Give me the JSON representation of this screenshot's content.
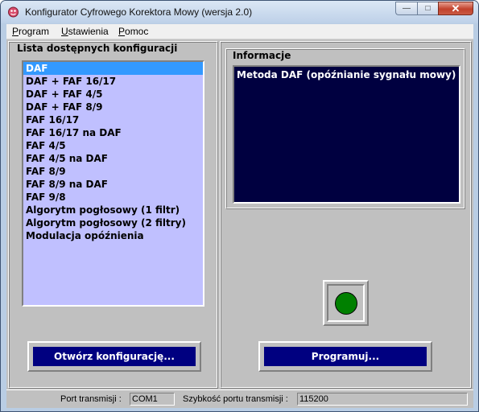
{
  "window": {
    "title": "Konfigurator Cyfrowego Korektora Mowy (wersja 2.0)"
  },
  "menu": [
    "Program",
    "Ustawienia",
    "Pomoc"
  ],
  "config_list": {
    "title": "Lista dostępnych konfiguracji",
    "selected": "DAF",
    "items": [
      "DAF",
      "DAF + FAF 16/17",
      "DAF + FAF 4/5",
      "DAF + FAF 8/9",
      "FAF 16/17",
      "FAF 16/17 na DAF",
      "FAF 4/5",
      "FAF 4/5 na DAF",
      "FAF 8/9",
      "FAF 8/9 na DAF",
      "FAF 9/8",
      "Algorytm pogłosowy (1 filtr)",
      "Algorytm pogłosowy (2 filtry)",
      "Modulacja opóźnienia"
    ]
  },
  "info": {
    "title": "Informacje",
    "text": "Metoda DAF (opóźnianie sygnału mowy)"
  },
  "status_led": {
    "state": "on",
    "color": "#008000"
  },
  "buttons": {
    "open": "Otwórz konfigurację...",
    "program": "Programuj..."
  },
  "statusbar": {
    "port_label": "Port transmisji :",
    "port_value": "COM1",
    "speed_label": "Szybkość portu transmisji :",
    "speed_value": "115200"
  }
}
